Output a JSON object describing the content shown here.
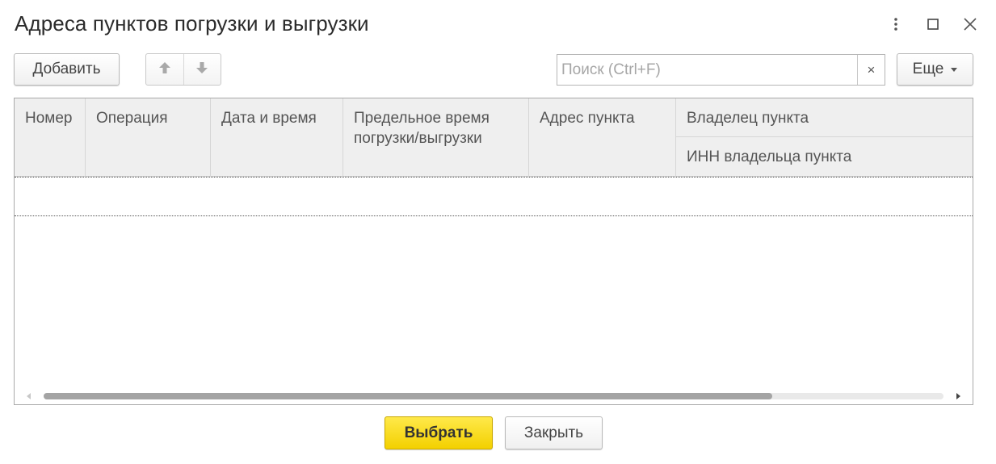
{
  "window": {
    "title": "Адреса пунктов погрузки и выгрузки",
    "controls": [
      "more-vertical-icon",
      "maximize-icon",
      "close-icon"
    ]
  },
  "toolbar": {
    "add_label": "Добавить",
    "move_up_icon": "arrow-up-icon",
    "move_down_icon": "arrow-down-icon",
    "search_placeholder": "Поиск (Ctrl+F)",
    "search_value": "",
    "search_clear": "×",
    "more_label": "Еще"
  },
  "table": {
    "columns": [
      {
        "label": "Номер"
      },
      {
        "label": "Операция"
      },
      {
        "label": "Дата и время"
      },
      {
        "label": "Предельное время погрузки/выгрузки"
      },
      {
        "label": "Адрес пункта"
      }
    ],
    "group_column": {
      "owner_label": "Владелец пункта",
      "inn_label": "ИНН владельца пункта"
    },
    "rows": [],
    "horizontal_scroll_position": 0.0,
    "horizontal_scroll_visible_fraction": 0.81
  },
  "footer": {
    "select_label": "Выбрать",
    "close_label": "Закрыть"
  },
  "colors": {
    "primary_button": "#f5d300",
    "header_background": "#efefef",
    "border": "#a9a9a9"
  }
}
